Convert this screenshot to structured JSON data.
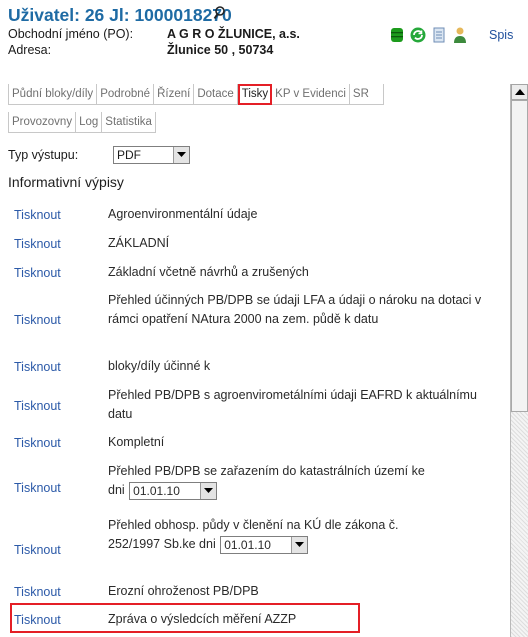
{
  "header": {
    "title": "Uživatel: 26 Jl: 1000018270",
    "title_icon": "magnifier-icon",
    "obchodni_label": "Obchodní jméno (PO):",
    "obchodni_value": "A G R O ŽLUNICE, a.s.",
    "adresa_label": "Adresa:",
    "adresa_value": "Žlunice 50 , 50734",
    "icons": [
      "database-icon",
      "refresh-icon",
      "document-icon",
      "user-icon"
    ],
    "spis_label": "Spis",
    "title_color": "#1f6ba4"
  },
  "tabs": {
    "row1": [
      {
        "label": "Půdní bloky/díly",
        "active": false
      },
      {
        "label": "Podrobné",
        "active": false
      },
      {
        "label": "Řízení",
        "active": false
      },
      {
        "label": "Dotace",
        "active": false
      },
      {
        "label": "Tisky",
        "active": true
      },
      {
        "label": "KP v Evidenci",
        "active": false
      },
      {
        "label": "SR",
        "active": false
      }
    ],
    "row2": [
      {
        "label": "Provozovny",
        "active": false
      },
      {
        "label": "Log",
        "active": false
      },
      {
        "label": "Statistika",
        "active": false
      }
    ],
    "active_border_color": "#e41f26"
  },
  "output": {
    "label": "Typ výstupu:",
    "value": "PDF"
  },
  "section_title": "Informativní výpisy",
  "link_label": "Tisknout",
  "link_color": "#2c5aa8",
  "reports": [
    {
      "text": "Agroenvironmentální údaje"
    },
    {
      "text": "ZÁKLADNÍ"
    },
    {
      "text": "Základní včetně návrhů a zrušených"
    },
    {
      "text": "Přehled účinných PB/DPB se údaji LFA a údaji o nároku na dotaci v rámci opatření NAtura 2000 na zem. půdě k datu"
    },
    {
      "text": "bloky/díly účinné k"
    },
    {
      "text": "Přehled PB/DPB s agroenvirometálními údaji EAFRD k aktuálnímu datu"
    },
    {
      "text": "Kompletní"
    },
    {
      "text": "Přehled PB/DPB se zařazením do katastrálních území ke dni",
      "date": "01.01.10"
    },
    {
      "text": "Přehled obhosp. půdy v členění na KÚ dle zákona č. 252/1997 Sb.ke dni",
      "date": "01.01.10"
    },
    {
      "text": "Erozní ohroženost PB/DPB"
    },
    {
      "text": "Zpráva o výsledcích měření AZZP",
      "highlighted": true
    }
  ]
}
